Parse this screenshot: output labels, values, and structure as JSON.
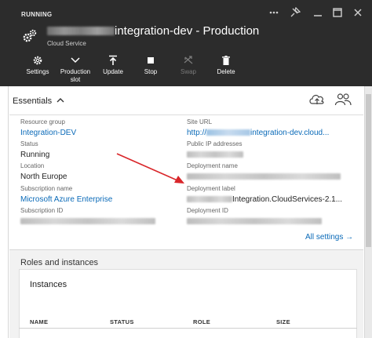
{
  "header": {
    "status": "RUNNING",
    "title_suffix": "integration-dev - Production",
    "subtitle": "Cloud Service",
    "window_controls": [
      "more-icon",
      "pin-icon",
      "minimize-icon",
      "maximize-icon",
      "close-icon"
    ]
  },
  "toolbar": {
    "settings": "Settings",
    "production_slot_1": "Production",
    "production_slot_2": "slot",
    "update": "Update",
    "stop": "Stop",
    "swap": "Swap",
    "delete": "Delete"
  },
  "essentials": {
    "title": "Essentials",
    "left": [
      {
        "label": "Resource group",
        "value": "Integration-DEV"
      },
      {
        "label": "Status",
        "value": "Running"
      },
      {
        "label": "Location",
        "value": "North Europe"
      },
      {
        "label": "Subscription name",
        "value": "Microsoft Azure Enterprise"
      },
      {
        "label": "Subscription ID",
        "value": ""
      }
    ],
    "right": [
      {
        "label": "Site URL",
        "value_prefix": "http://",
        "value_suffix": "integration-dev.cloud..."
      },
      {
        "label": "Public IP addresses",
        "value": ""
      },
      {
        "label": "Deployment name",
        "value": ""
      },
      {
        "label": "Deployment label",
        "value_suffix": "Integration.CloudServices-2.1..."
      },
      {
        "label": "Deployment ID",
        "value": ""
      }
    ],
    "all_settings": "All settings"
  },
  "roles": {
    "title": "Roles and instances",
    "instances_title": "Instances",
    "columns": [
      "NAME",
      "STATUS",
      "ROLE",
      "SIZE"
    ]
  },
  "colors": {
    "header_bg": "#2c2c2c",
    "link": "#0a6ab8",
    "annotation_arrow": "#d9262a"
  }
}
